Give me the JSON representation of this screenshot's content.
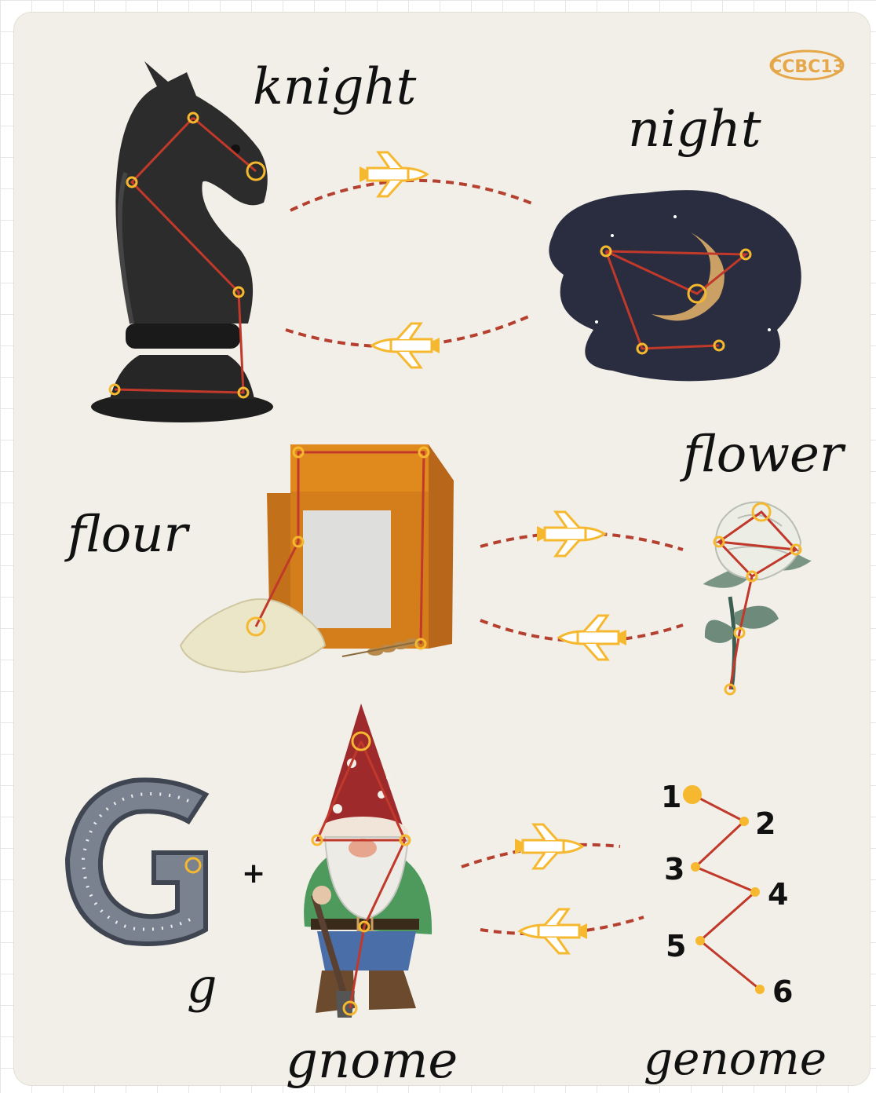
{
  "logo": {
    "text": "CCBC13"
  },
  "rows": [
    {
      "left_word": "knight",
      "right_word": "night"
    },
    {
      "left_word": "flour",
      "right_word": "flower"
    },
    {
      "left_letter": "g",
      "plus": "+",
      "middle_word": "gnome",
      "right_word": "genome"
    }
  ],
  "genome_steps": [
    "1",
    "2",
    "3",
    "4",
    "5",
    "6"
  ],
  "icons": [
    "knight-chess-piece",
    "crescent-moon-night-sky",
    "flour-bag",
    "rose-flower",
    "letter-g",
    "garden-gnome",
    "space-shuttle",
    "constellation-dots"
  ],
  "colors": {
    "background": "#f1efe7",
    "constellation_line": "#c0392b",
    "constellation_dot": "#f5b82e",
    "shuttle": "#f5b82e",
    "dashed_path": "#b5402f"
  }
}
